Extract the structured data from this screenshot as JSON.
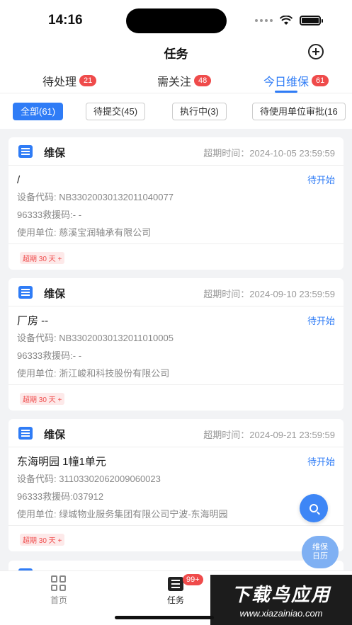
{
  "status_bar": {
    "time": "14:16"
  },
  "nav": {
    "title": "任务"
  },
  "tabs": [
    {
      "label": "待处理",
      "badge": "21"
    },
    {
      "label": "需关注",
      "badge": "48"
    },
    {
      "label": "今日维保",
      "badge": "61",
      "active": true
    }
  ],
  "filters": [
    "全部(61)",
    "待提交(45)",
    "执行中(3)",
    "待使用单位审批(16"
  ],
  "cards": [
    {
      "type": "维保",
      "deadline": "超期时间：2024-10-05 23:59:59",
      "title": "/",
      "status": "待开始",
      "device_code": "设备代码: NB33020030132011040077",
      "rescue_code": "96333救援码:- -",
      "unit": "使用单位: 慈溪宝润轴承有限公司",
      "tag": "超期 30 天 +"
    },
    {
      "type": "维保",
      "deadline": "超期时间：2024-09-10 23:59:59",
      "title": "厂房  --",
      "status": "待开始",
      "device_code": "设备代码: NB33020030132011010005",
      "rescue_code": "96333救援码:- -",
      "unit": "使用单位: 浙江峻和科技股份有限公司",
      "tag": "超期 30 天 +"
    },
    {
      "type": "维保",
      "deadline": "超期时间：2024-09-21 23:59:59",
      "title": "东海明园  1幢1单元",
      "status": "待开始",
      "device_code": "设备代码: 31103302062009060023",
      "rescue_code": "96333救援码:037912",
      "unit": "使用单位: 绿城物业服务集团有限公司宁波-东海明园",
      "tag": "超期 30 天 +"
    }
  ],
  "fab": {
    "calendar_line1": "维保",
    "calendar_line2": "日历"
  },
  "bottom_bar": {
    "home_label": "首页",
    "task_label": "任务",
    "task_badge": "99+"
  },
  "watermark": {
    "title": "下载鸟应用",
    "url": "www.xiazainiao.com"
  },
  "colors": {
    "accent": "#2f7cf6",
    "badge": "#ef4b4b"
  }
}
